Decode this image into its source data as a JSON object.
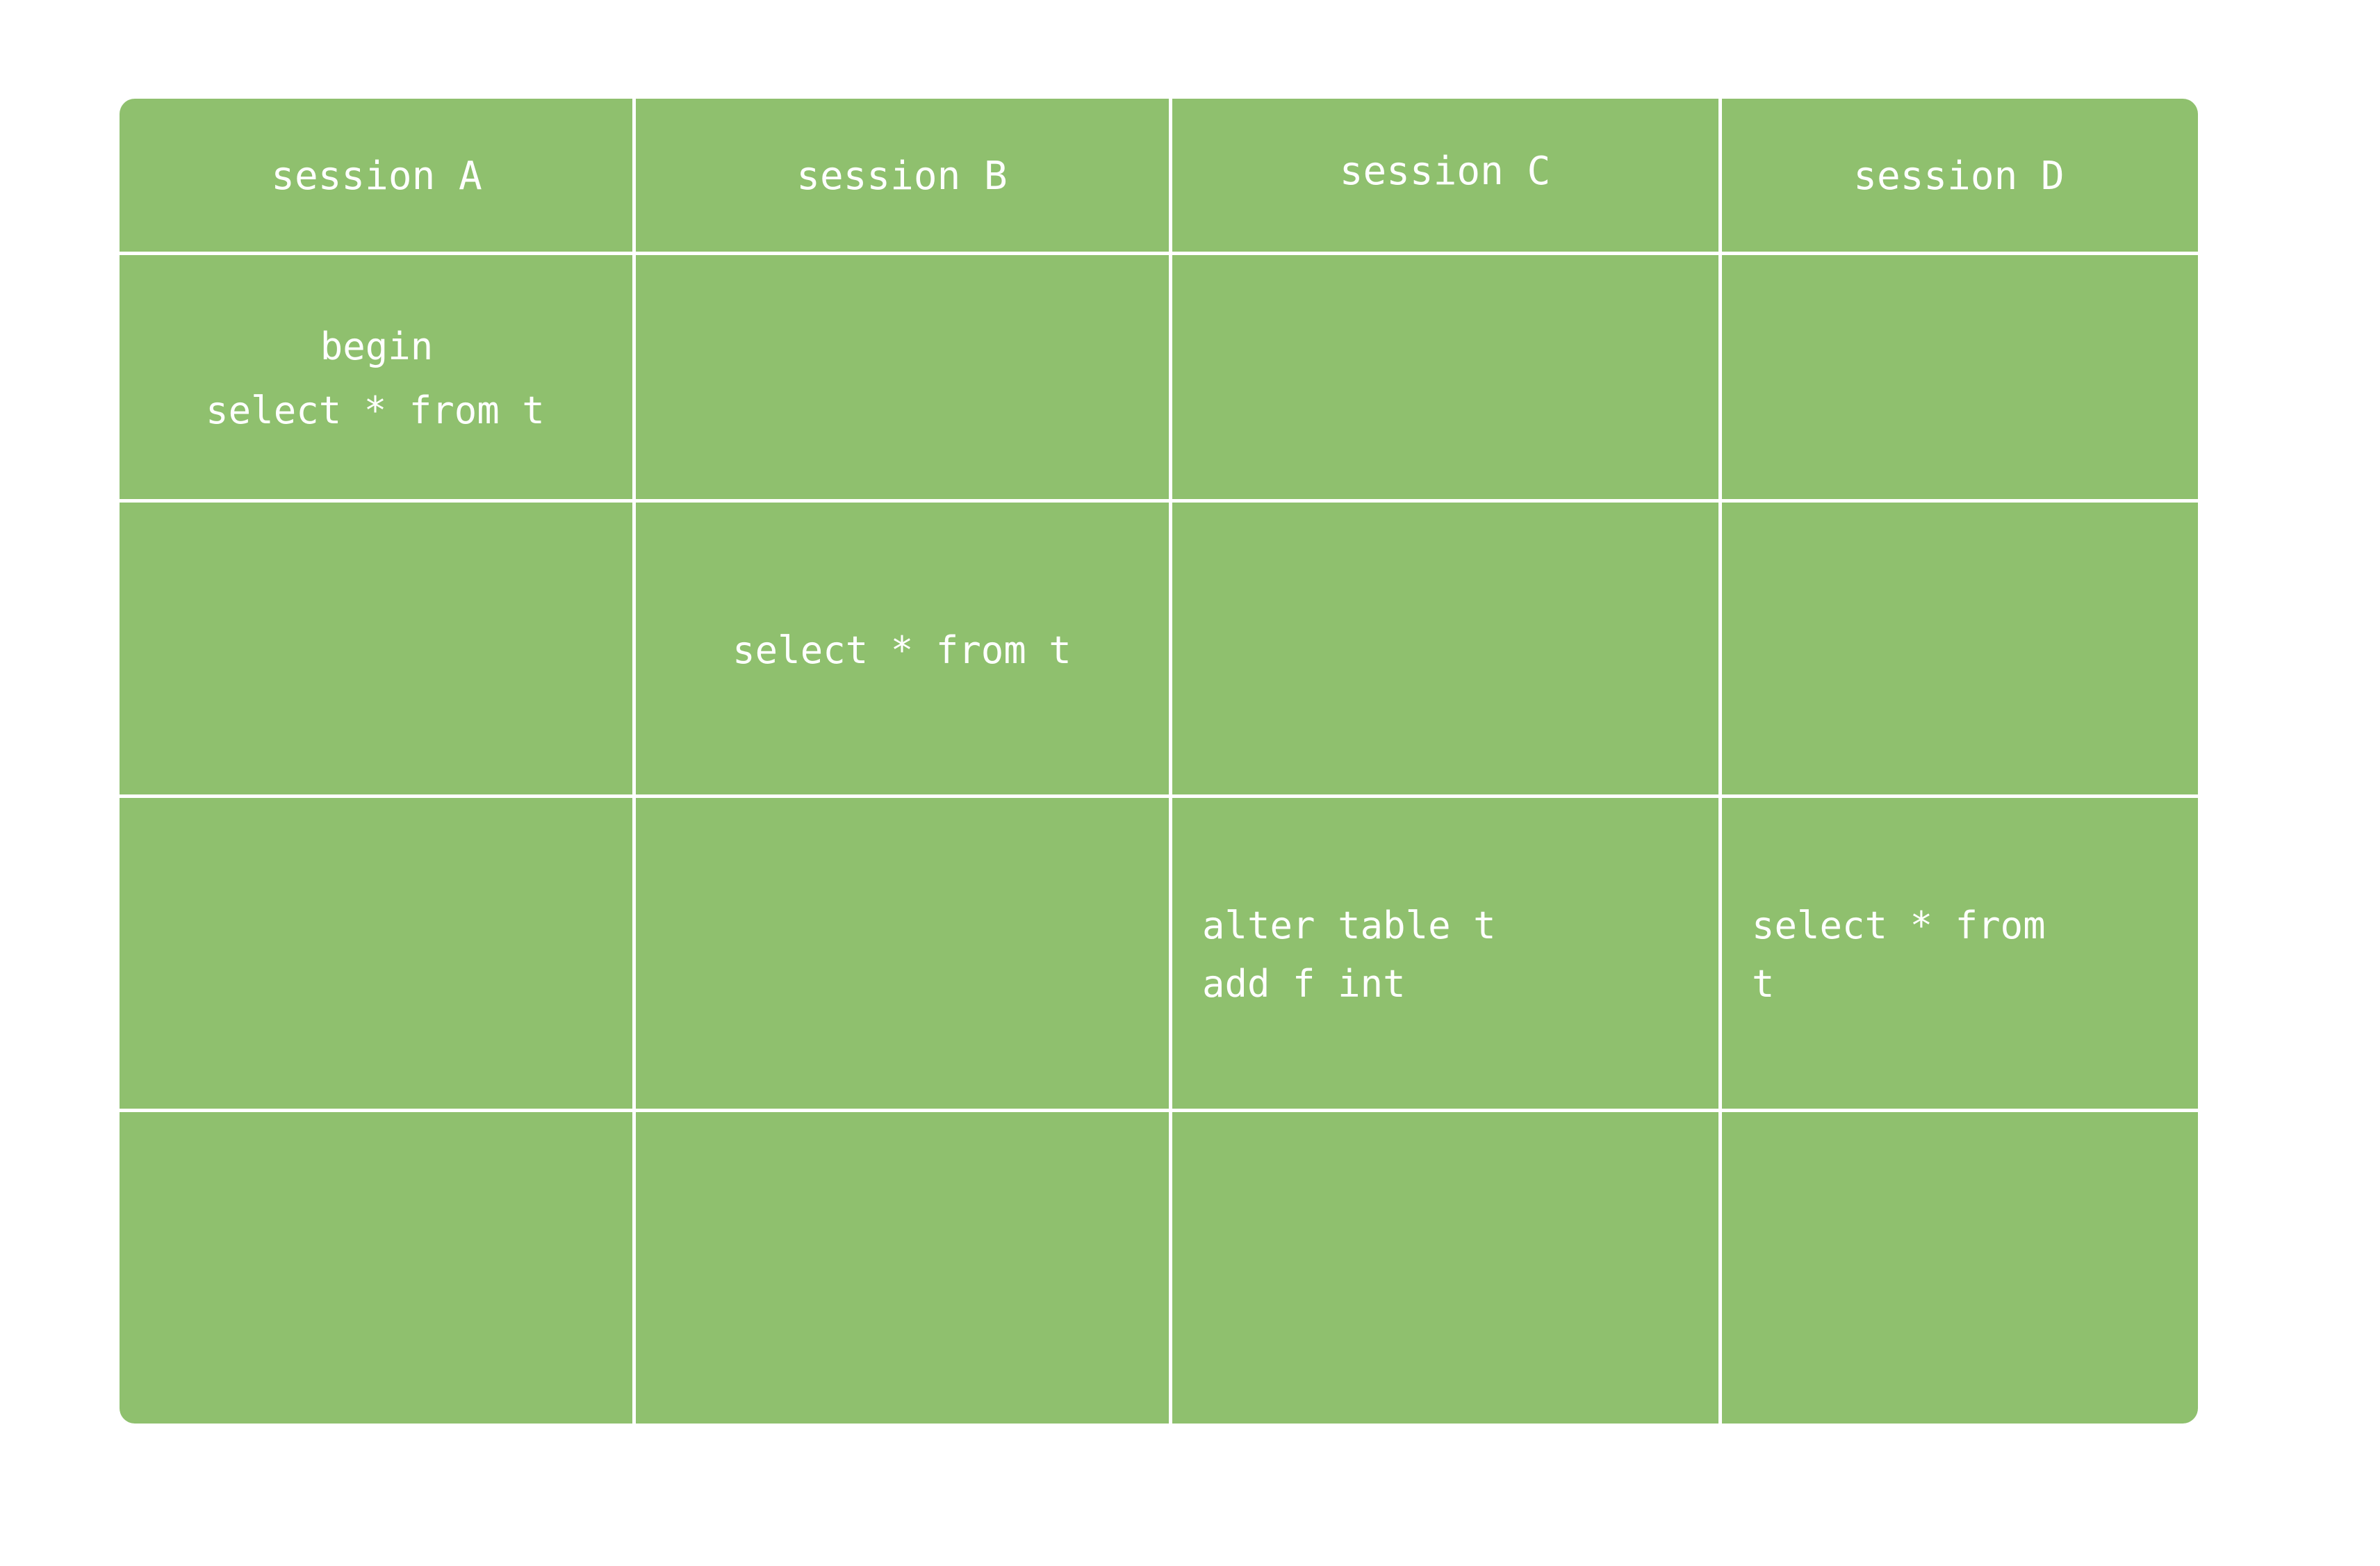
{
  "diagram": {
    "type": "table",
    "title": "MySQL session timeline table",
    "accent_color": "#8FC06E",
    "text_color": "#FFFFFF",
    "background_color": "#FFFFFF",
    "columns": [
      {
        "key": "session_a",
        "header": "session A"
      },
      {
        "key": "session_b",
        "header": "session B"
      },
      {
        "key": "session_c",
        "header": "session C"
      },
      {
        "key": "session_d",
        "header": "session D"
      }
    ],
    "rows": [
      {
        "id": "row-1",
        "cells": {
          "session_a": {
            "lines": [
              "begin",
              "select * from t"
            ],
            "align": "center"
          },
          "session_b": {
            "lines": [],
            "align": "center"
          },
          "session_c": {
            "lines": [],
            "align": "center"
          },
          "session_d": {
            "lines": [],
            "align": "center"
          }
        }
      },
      {
        "id": "row-2",
        "cells": {
          "session_a": {
            "lines": [],
            "align": "center"
          },
          "session_b": {
            "lines": [
              "select * from t"
            ],
            "align": "center"
          },
          "session_c": {
            "lines": [],
            "align": "center"
          },
          "session_d": {
            "lines": [],
            "align": "center"
          }
        }
      },
      {
        "id": "row-3",
        "cells": {
          "session_a": {
            "lines": [],
            "align": "center"
          },
          "session_b": {
            "lines": [],
            "align": "center"
          },
          "session_c": {
            "lines": [
              "alter table t",
              "add f int"
            ],
            "align": "left"
          },
          "session_d": {
            "lines": [
              "select * from",
              "t"
            ],
            "align": "left"
          }
        }
      },
      {
        "id": "row-4",
        "cells": {
          "session_a": {
            "lines": [],
            "align": "center"
          },
          "session_b": {
            "lines": [],
            "align": "center"
          },
          "session_c": {
            "lines": [],
            "align": "center"
          },
          "session_d": {
            "lines": [],
            "align": "center"
          }
        }
      }
    ]
  },
  "watermark": {
    "text": ""
  }
}
